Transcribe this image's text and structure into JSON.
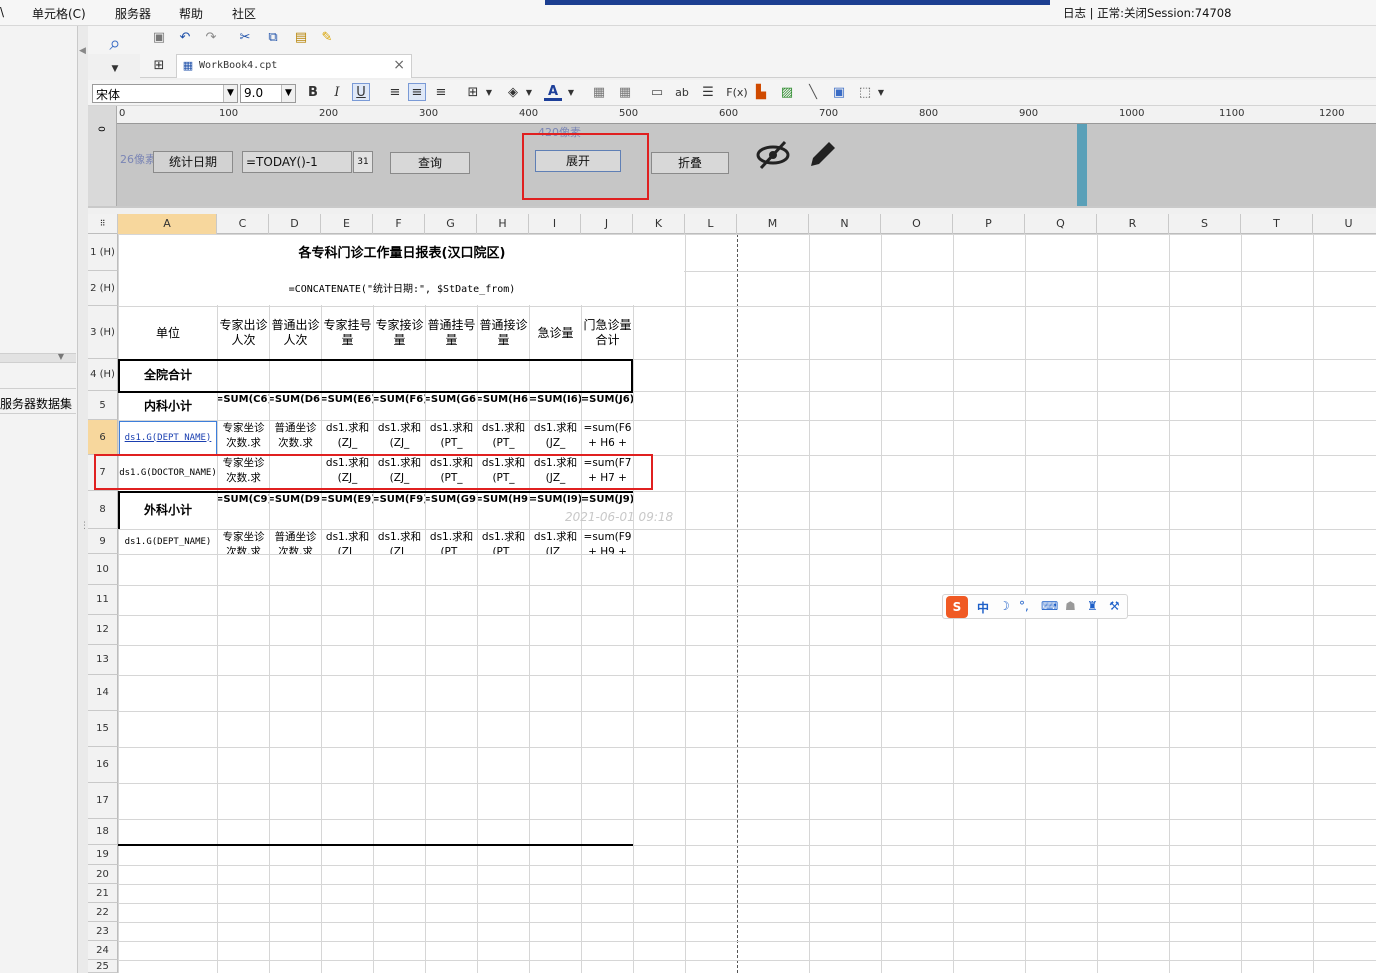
{
  "menu": {
    "items": [
      "单元格(C)",
      "服务器",
      "帮助",
      "社区"
    ],
    "status": "日志 | 正常:关闭Session:74708",
    "left_glyph": "\\"
  },
  "tab": {
    "name": "WorkBook4.cpt",
    "close": "×"
  },
  "format": {
    "font": "宋体",
    "size": "9.0",
    "bold": "B",
    "italic": "I",
    "underline": "U",
    "text_ab": "ab",
    "fx": "F(x)",
    "color_a": "A"
  },
  "left_panel": {
    "dataset_label": "服务器数据集"
  },
  "ruler": {
    "ticks": [
      "0",
      "100",
      "200",
      "300",
      "400",
      "500",
      "600",
      "700",
      "800",
      "900",
      "1000",
      "1100",
      "1200"
    ],
    "vtick": "0"
  },
  "params": {
    "label_date": "统计日期",
    "date_value": "=TODAY()-1",
    "query": "查询",
    "expand": "展开",
    "collapse": "折叠",
    "px420": "420像素",
    "px26": "26像素",
    "calendar": "31"
  },
  "columns": [
    "A",
    "C",
    "D",
    "E",
    "F",
    "G",
    "H",
    "I",
    "J",
    "K",
    "L",
    "M",
    "N",
    "O",
    "P",
    "Q",
    "R",
    "S",
    "T",
    "U"
  ],
  "rows": [
    "1 (H)",
    "2 (H)",
    "3 (H)",
    "4 (H)",
    "5",
    "6",
    "7",
    "8",
    "9",
    "10",
    "11",
    "12",
    "13",
    "14",
    "15",
    "16",
    "17",
    "18",
    "19",
    "20",
    "21",
    "22",
    "23",
    "24",
    "25"
  ],
  "report": {
    "title": "各专科门诊工作量日报表(汉口院区)",
    "subtitle": "=CONCATENATE(\"统计日期:\", $StDate_from)",
    "headers": [
      "单位",
      "专家出诊人次",
      "普通出诊人次",
      "专家挂号量",
      "专家接诊量",
      "普通挂号量",
      "普通接诊量",
      "急诊量",
      "门急诊量合计"
    ],
    "r4": "全院合计",
    "r5": {
      "label": "内科小计",
      "vals": [
        "=SUM(C6)",
        "=SUM(D6)",
        "=SUM(E6)",
        "=SUM(F6)",
        "=SUM(G6)",
        "=SUM(H6)",
        "=SUM(I6)",
        "=SUM(J6)"
      ]
    },
    "r6": {
      "label": "ds1.G(DEPT_NAME)",
      "vals": [
        "专家坐诊次数.求",
        "普通坐诊次数.求",
        "ds1.求和(ZJ_",
        "ds1.求和(ZJ_",
        "ds1.求和(PT_",
        "ds1.求和(PT_",
        "ds1.求和(JZ_",
        "=sum(F6 + H6 +"
      ]
    },
    "r7": {
      "label": "ds1.G(DOCTOR_NAME)",
      "vals": [
        "专家坐诊次数.求",
        "",
        "ds1.求和(ZJ_",
        "ds1.求和(ZJ_",
        "ds1.求和(PT_",
        "ds1.求和(PT_",
        "ds1.求和(JZ_",
        "=sum(F7 + H7 +"
      ]
    },
    "r8": {
      "label": "外科小计",
      "vals": [
        "=SUM(C9)",
        "=SUM(D9)",
        "=SUM(E9)",
        "=SUM(F9)",
        "=SUM(G9)",
        "=SUM(H9)",
        "=SUM(I9)",
        "=SUM(J9)"
      ]
    },
    "r9": {
      "label": "ds1.G(DEPT_NAME)",
      "vals": [
        "专家坐诊次数.求",
        "普通坐诊次数.求",
        "ds1.求和(ZJ_",
        "ds1.求和(ZJ_",
        "ds1.求和(PT_",
        "ds1.求和(PT_",
        "ds1.求和(JZ_",
        "=sum(F9 + H9 +"
      ]
    },
    "watermark": "2021-06-01 09:18"
  },
  "ime": {
    "logo": "S",
    "lang": "中",
    "items": [
      "☽",
      "°,",
      "⌨",
      "☗",
      "♜",
      "⚒"
    ]
  },
  "colors": {
    "red_box": "#e02020",
    "blue_band": "#1c3f91",
    "selected_col": "#f7d79d"
  }
}
